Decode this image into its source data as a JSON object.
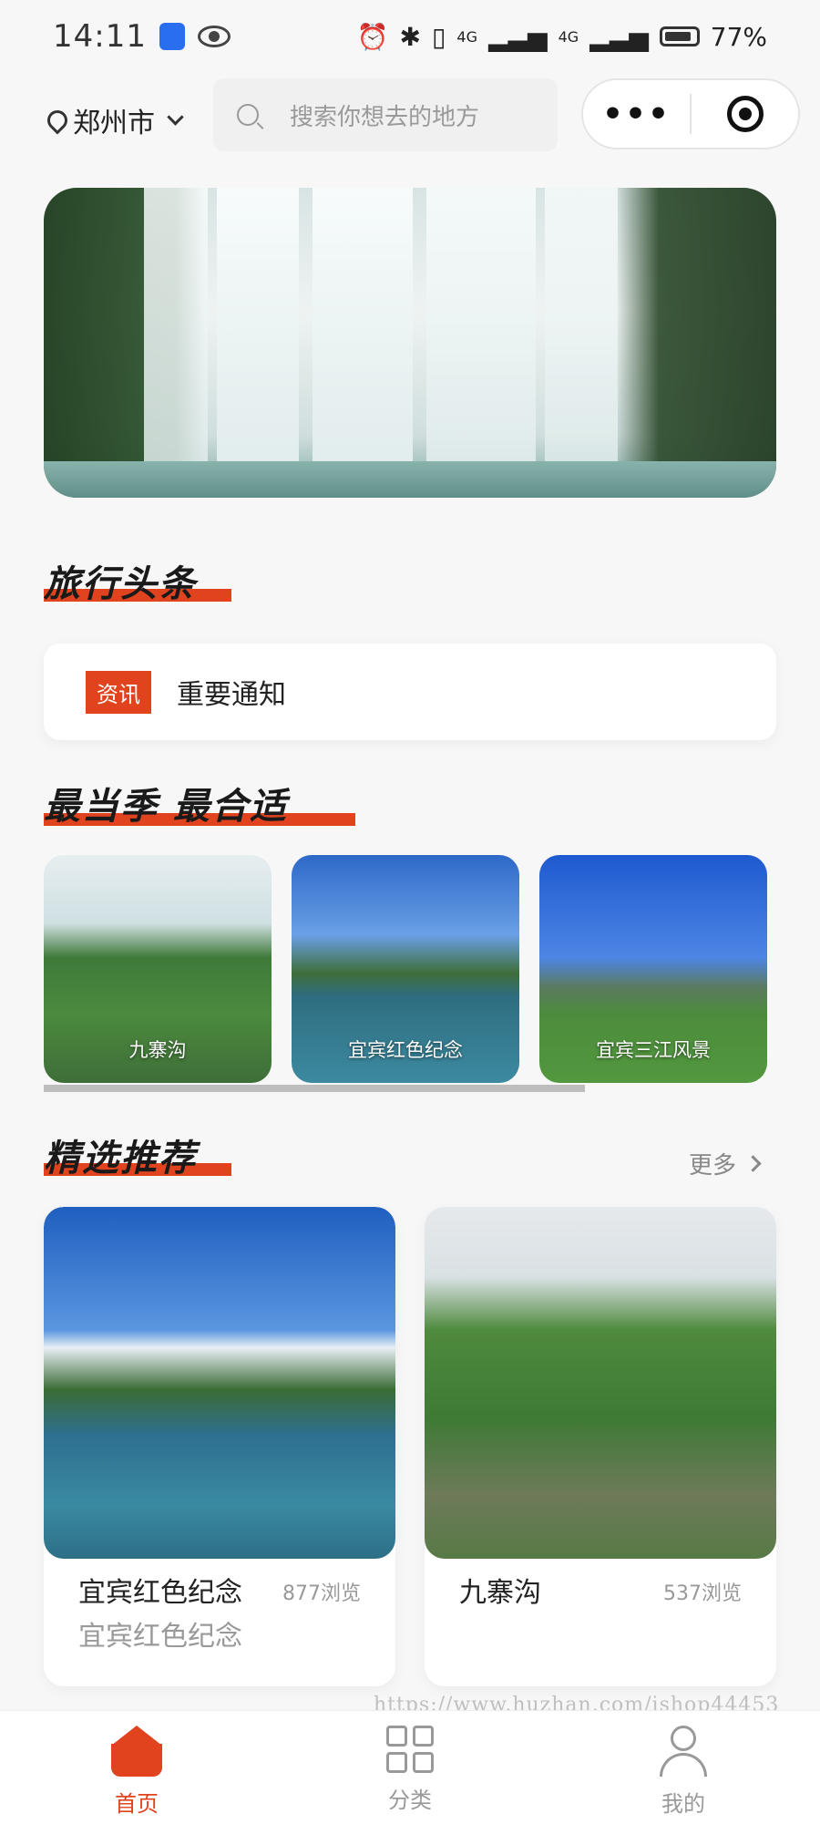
{
  "status_bar": {
    "time": "14:11",
    "battery": "77%",
    "net1": "4G",
    "net2": "4G"
  },
  "header": {
    "city": "郑州市",
    "search_placeholder": "搜索你想去的地方"
  },
  "sections": {
    "travel_news_title": "旅行头条",
    "season_title": "最当季 最合适",
    "featured_title": "精选推荐",
    "more_label": "更多"
  },
  "news": {
    "tag": "资讯",
    "text": "重要通知"
  },
  "season_items": [
    {
      "label": "九寨沟"
    },
    {
      "label": "宜宾红色纪念"
    },
    {
      "label": "宜宾三江风景"
    }
  ],
  "featured": [
    {
      "title": "宜宾红色纪念",
      "views": "877浏览",
      "subtitle": "宜宾红色纪念"
    },
    {
      "title": "九寨沟",
      "views": "537浏览"
    }
  ],
  "watermark": "https://www.huzhan.com/ishop44453",
  "tabs": [
    {
      "label": "首页",
      "color": "#e0431e",
      "active": true
    },
    {
      "label": "分类",
      "color": "#999999",
      "active": false
    },
    {
      "label": "我的",
      "color": "#999999",
      "active": false
    }
  ],
  "theme": {
    "accent": "#e0431e"
  }
}
